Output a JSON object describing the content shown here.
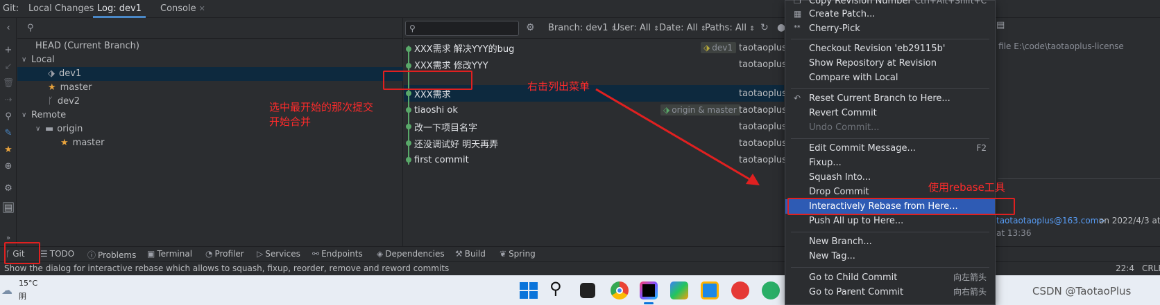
{
  "tabbar": {
    "git_label": "Git:",
    "tabs": [
      "Local Changes",
      "Log: dev1",
      "Console"
    ]
  },
  "branches": {
    "head": "HEAD (Current Branch)",
    "local_group": "Local",
    "local_items": [
      "dev1",
      "master",
      "dev2"
    ],
    "remote_group": "Remote",
    "remote_folder": "origin",
    "remote_items": [
      "master"
    ]
  },
  "log_toolbar": {
    "branch": "Branch: dev1",
    "user": "User: All",
    "date": "Date: All",
    "paths": "Paths: All"
  },
  "commits": [
    {
      "message": "XXX需求 解决YYY的bug",
      "author": "taotaoplus",
      "tag": "dev1"
    },
    {
      "message": "XXX需求 修改YYY",
      "author": "taotaoplus",
      "tag": ""
    },
    {
      "message": "XXX需求",
      "author": "taotaoplus",
      "tag": ""
    },
    {
      "message": "tiaoshi ok",
      "author": "taotaoplus",
      "tag": "origin & master"
    },
    {
      "message": "改一下项目名字",
      "author": "taotaoplus",
      "tag": ""
    },
    {
      "message": "还没调试好   明天再弄",
      "author": "taotaoplus",
      "tag": ""
    },
    {
      "message": "first commit",
      "author": "taotaoplus",
      "tag": ""
    }
  ],
  "details": {
    "path": "l file  E:\\code\\taotaoplus-license",
    "email": "taotaotaoplus@163.com>",
    "date": "on 2022/4/3 at",
    "time": "at 13:36"
  },
  "menu": {
    "items": [
      {
        "label": "Copy Revision Number",
        "shortcut": "Ctrl+Alt+Shift+C"
      },
      {
        "label": "Create Patch...",
        "shortcut": ""
      },
      {
        "label": "Cherry-Pick",
        "shortcut": ""
      },
      {
        "label": "Checkout Revision 'eb29115b'",
        "shortcut": ""
      },
      {
        "label": "Show Repository at Revision",
        "shortcut": ""
      },
      {
        "label": "Compare with Local",
        "shortcut": ""
      },
      {
        "label": "Reset Current Branch to Here...",
        "shortcut": ""
      },
      {
        "label": "Revert Commit",
        "shortcut": ""
      },
      {
        "label": "Undo Commit...",
        "shortcut": ""
      },
      {
        "label": "Edit Commit Message...",
        "shortcut": "F2"
      },
      {
        "label": "Fixup...",
        "shortcut": ""
      },
      {
        "label": "Squash Into...",
        "shortcut": ""
      },
      {
        "label": "Drop Commit",
        "shortcut": ""
      },
      {
        "label": "Interactively Rebase from Here...",
        "shortcut": ""
      },
      {
        "label": "Push All up to Here...",
        "shortcut": ""
      },
      {
        "label": "New Branch...",
        "shortcut": ""
      },
      {
        "label": "New Tag...",
        "shortcut": ""
      },
      {
        "label": "Go to Child Commit",
        "shortcut": "向左箭头"
      },
      {
        "label": "Go to Parent Commit",
        "shortcut": "向右箭头"
      }
    ]
  },
  "bottom_tools": [
    "Git",
    "TODO",
    "Problems",
    "Terminal",
    "Profiler",
    "Services",
    "Endpoints",
    "Dependencies",
    "Build",
    "Spring"
  ],
  "status": {
    "message": "Show the dialog for interactive rebase which allows to squash, fixup, reorder, remove and reword commits",
    "position": "22:4",
    "line_sep": "CRLF"
  },
  "taskbar": {
    "temp": "15°C",
    "weather": "阴",
    "watermark": "CSDN @TaotaoPlus"
  },
  "annotations": {
    "select_note_1": "选中最开始的那次提交",
    "select_note_2": "开始合并",
    "menu_note": "右击列出菜单",
    "rebase_note": "使用rebase工具"
  }
}
